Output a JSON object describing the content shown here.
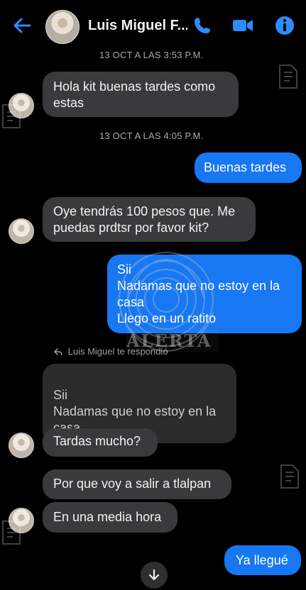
{
  "header": {
    "contact_name": "Luis Miguel F...",
    "icons": {
      "back": "back-arrow-icon",
      "avatar": "profile-avatar",
      "phone": "phone-icon",
      "video": "video-camera-icon",
      "info": "info-icon"
    },
    "colors": {
      "accent": "#1877f2"
    }
  },
  "timestamps": [
    "13 OCT A LAS 3:53 P.M.",
    "13 OCT A LAS 4:05 P.M."
  ],
  "messages": [
    {
      "text": "Hola kit buenas tardes como estas"
    },
    {
      "text": "Buenas tardes"
    },
    {
      "text": "Oye tendrás 100 pesos que. Me puedas prdtsr por favor kit?"
    },
    {
      "text": "Sii\nNadamas que no estoy en la casa\nLlego en un ratito"
    },
    {
      "reply_label": "Luis Miguel te respondió",
      "quoted_text": "Sii\nNadamas que no estoy en la casa ...",
      "text": "Tardas mucho?"
    },
    {
      "text": "Por que voy a salir a tlalpan"
    },
    {
      "text": "En una media hora"
    },
    {
      "text": "Ya llegué"
    }
  ],
  "watermark": {
    "text": "ALERTA"
  },
  "footer": {
    "scroll_button_icon": "chevron-down-icon"
  }
}
